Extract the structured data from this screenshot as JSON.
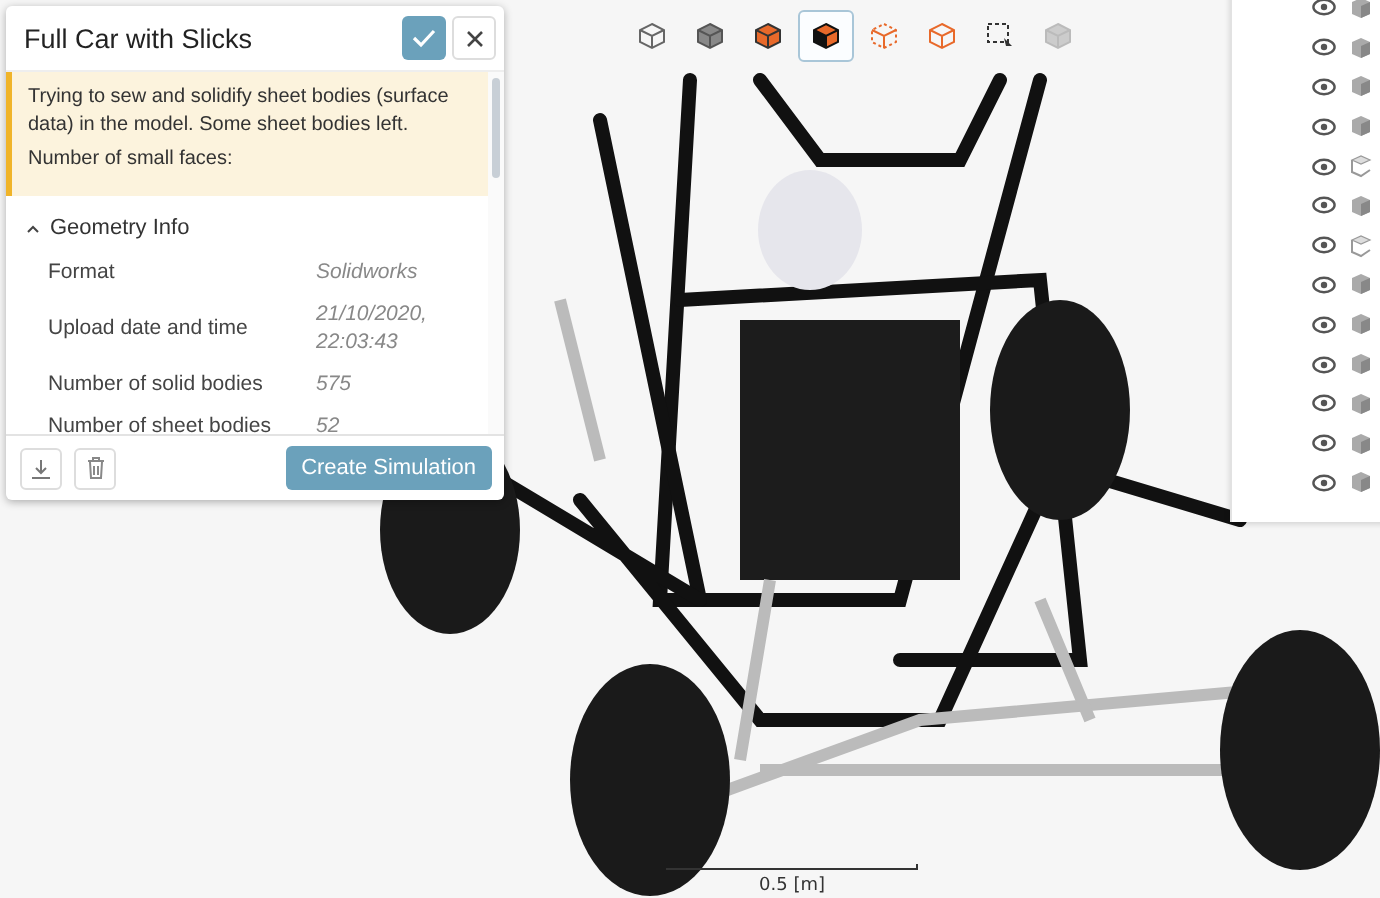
{
  "dialog": {
    "title": "Full Car with Slicks",
    "warning": [
      "Trying to sew and solidify sheet bodies (surface data) in the model. Some sheet bodies left.",
      "Number of small faces:"
    ],
    "section": {
      "title": "Geometry Info",
      "expanded": true,
      "rows": [
        {
          "label": "Format",
          "value": "Solidworks"
        },
        {
          "label": "Upload date and time",
          "value": "21/10/2020, 22:03:43"
        },
        {
          "label": "Number of solid bodies",
          "value": "575"
        },
        {
          "label": "Number of sheet bodies",
          "value": "52"
        }
      ]
    },
    "primary_button": "Create Simulation"
  },
  "toolbar": [
    {
      "kind": "outline",
      "selected": false
    },
    {
      "kind": "grey",
      "selected": false
    },
    {
      "kind": "orange",
      "selected": false
    },
    {
      "kind": "split",
      "selected": true
    },
    {
      "kind": "dotted",
      "selected": false
    },
    {
      "kind": "wire",
      "selected": false
    },
    {
      "kind": "select",
      "selected": false
    },
    {
      "kind": "faded",
      "selected": false
    }
  ],
  "tree_rows": [
    {
      "kind": "solid"
    },
    {
      "kind": "solid"
    },
    {
      "kind": "solid"
    },
    {
      "kind": "solid"
    },
    {
      "kind": "sheet"
    },
    {
      "kind": "solid"
    },
    {
      "kind": "sheet"
    },
    {
      "kind": "solid"
    },
    {
      "kind": "solid"
    },
    {
      "kind": "solid"
    },
    {
      "kind": "solid"
    },
    {
      "kind": "solid"
    },
    {
      "kind": "solid"
    }
  ],
  "scale_bar": "0.5 [m]"
}
